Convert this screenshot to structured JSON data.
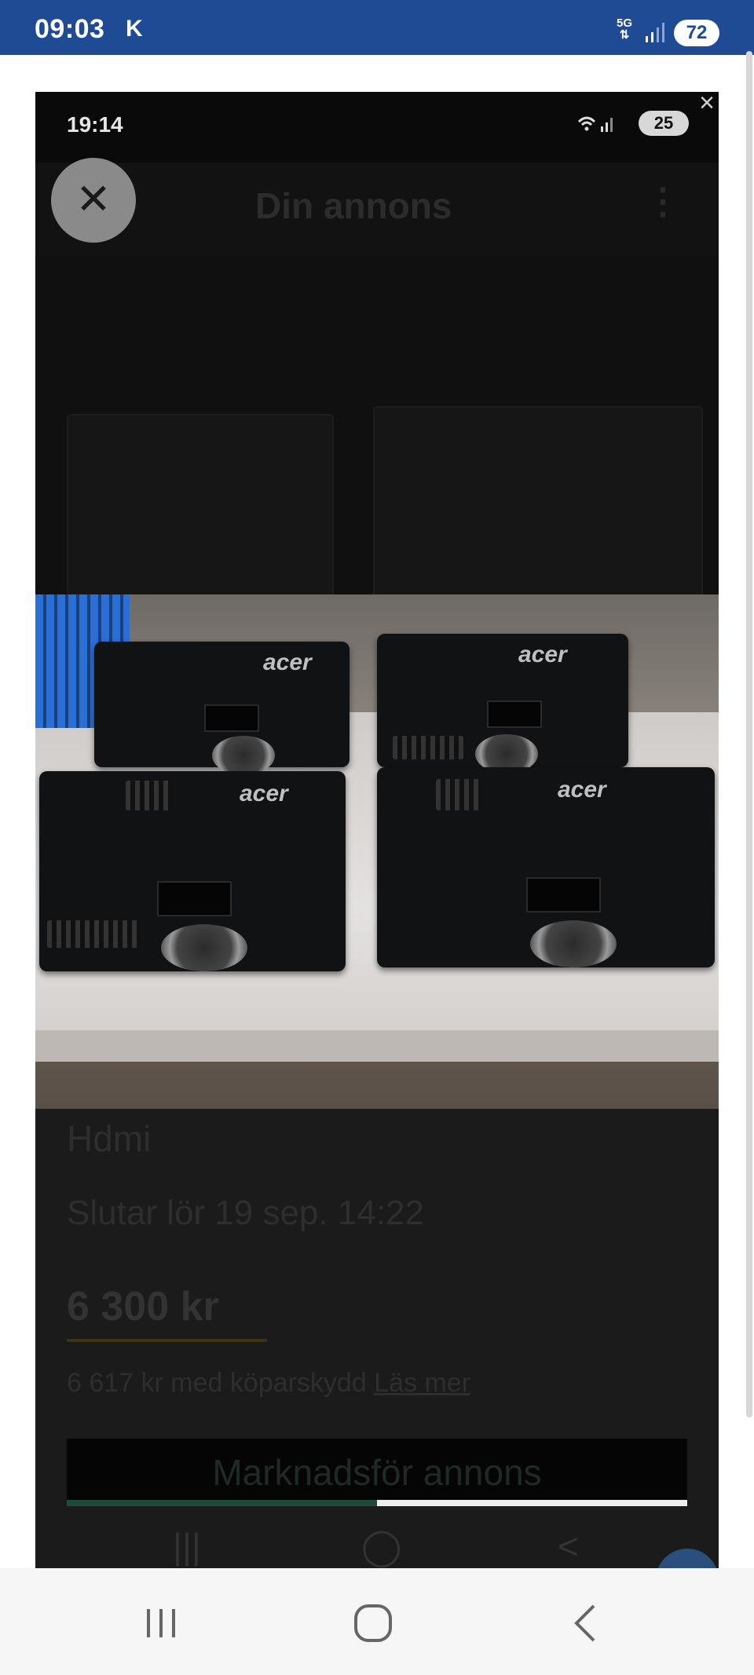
{
  "status_bar": {
    "time": "09:03",
    "carrier": "K",
    "network": "5G",
    "battery": "72"
  },
  "viewer": {
    "inner_status": {
      "time": "19:14",
      "battery": "25"
    },
    "close_icon": "×",
    "dim_header": {
      "title": "Din annons",
      "more_icon": "⋮",
      "close_icon": "✕"
    },
    "photo": {
      "brands": [
        "acer",
        "acer",
        "acer",
        "acer"
      ]
    },
    "listing": {
      "title_line2": "Hdmi",
      "ends": "Slutar lör 19 sep. 14:22",
      "price": "6 300 kr",
      "protect_text": "6 617 kr med köparskydd",
      "protect_link": "Läs mer",
      "button": "Marknadsför annons",
      "progress": 0.5,
      "nav": [
        "|||",
        "◯",
        "<"
      ]
    }
  },
  "bottom_nav": {
    "recent": "recent-apps-icon",
    "home": "home-icon",
    "back": "back-icon"
  }
}
